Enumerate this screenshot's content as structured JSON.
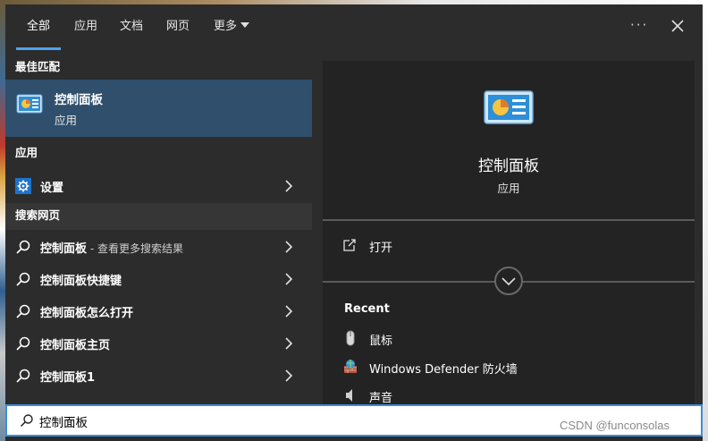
{
  "tabs": [
    {
      "label": "全部"
    },
    {
      "label": "应用"
    },
    {
      "label": "文档"
    },
    {
      "label": "网页"
    },
    {
      "label": "更多"
    }
  ],
  "more_menu": "···",
  "sections": {
    "best_match": "最佳匹配",
    "apps": "应用",
    "web": "搜索网页"
  },
  "best_match": {
    "title": "控制面板",
    "subtitle": "应用"
  },
  "apps": [
    {
      "label": "设置"
    }
  ],
  "web_results": [
    {
      "label": "控制面板",
      "suffix": " - 查看更多搜索结果"
    },
    {
      "label": "控制面板快捷键",
      "suffix": ""
    },
    {
      "label": "控制面板怎么打开",
      "suffix": ""
    },
    {
      "label": "控制面板主页",
      "suffix": ""
    },
    {
      "label": "控制面板1",
      "suffix": ""
    }
  ],
  "preview": {
    "title": "控制面板",
    "subtitle": "应用",
    "open_label": "打开",
    "recent_label": "Recent",
    "recent": [
      {
        "label": "鼠标"
      },
      {
        "label": "Windows Defender 防火墙"
      },
      {
        "label": "声音"
      }
    ]
  },
  "search": {
    "value": "控制面板"
  },
  "watermark": "CSDN @funconsolas",
  "colors": {
    "accent": "#4ea2ef",
    "selected": "#2f4f6d",
    "panel": "#2c2c2c",
    "preview": "#232323"
  }
}
